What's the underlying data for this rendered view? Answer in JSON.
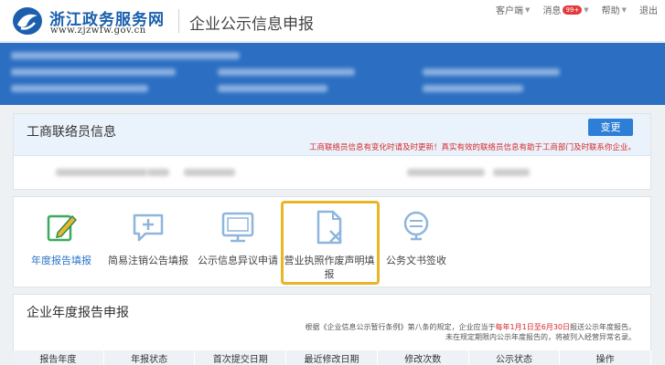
{
  "header": {
    "logo_title": "浙江政务服务网",
    "logo_url": "www.zjzwfw.gov.cn",
    "page_heading": "企业公示信息申报",
    "nav": {
      "client": "客户端",
      "messages": "消息",
      "message_badge": "99+",
      "help": "帮助",
      "logout": "退出"
    }
  },
  "liaison": {
    "title": "工商联络员信息",
    "change_button": "变更",
    "notice": "工商联络员信息有变化时请及时更新！真实有效的联络员信息有助于工商部门及时联系你企业。"
  },
  "services": [
    {
      "label": "年度报告填报",
      "icon": "edit-icon"
    },
    {
      "label": "简易注销公告填报",
      "icon": "chat-add-icon"
    },
    {
      "label": "公示信息异议申请",
      "icon": "monitor-icon"
    },
    {
      "label": "营业执照作废声明填报",
      "icon": "document-cancel-icon"
    },
    {
      "label": "公务文书签收",
      "icon": "stamp-icon"
    }
  ],
  "annual_report": {
    "title": "企业年度报告申报",
    "rule_line1_prefix": "根据《企业信息公示暂行条例》第八条的规定，企业应当于",
    "rule_line1_highlight": "每年1月1日至6月30日",
    "rule_line1_suffix": "报送公示年度报告。",
    "rule_line2": "未在规定期限内公示年度报告的，将被列入经营异常名录。",
    "columns": [
      "报告年度",
      "年报状态",
      "首次提交日期",
      "最近修改日期",
      "修改次数",
      "公示状态",
      "操作"
    ]
  },
  "colors": {
    "banner": "#2c6fc2",
    "accent": "#2c7ed6",
    "highlight_border": "#e8b528",
    "notice_red": "#d6272c"
  }
}
